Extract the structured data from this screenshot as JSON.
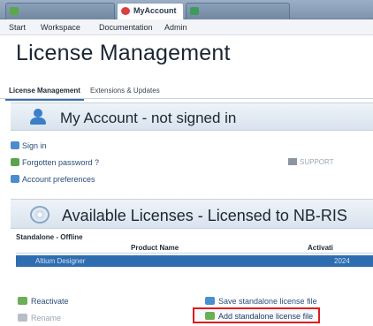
{
  "tabs": [
    {
      "label": "",
      "active": false
    },
    {
      "label": "MyAccount",
      "active": true
    },
    {
      "label": "",
      "active": false
    }
  ],
  "menu": {
    "start": "Start",
    "workspace": "Workspace",
    "documentation": "Documentation",
    "admin": "Admin"
  },
  "page": {
    "title": "License Management"
  },
  "subtabs": {
    "license_management": "License Management",
    "extensions_updates": "Extensions & Updates"
  },
  "account": {
    "title": "My Account - not signed in",
    "links": {
      "sign_in": "Sign in",
      "forgotten_password": "Forgotten password ?",
      "account_preferences": "Account preferences",
      "support": "SUPPORT"
    }
  },
  "licenses": {
    "title": "Available Licenses - Licensed to NB-RIS",
    "group": "Standalone - Offline",
    "columns": {
      "product_name": "Product Name",
      "activation": "Activati"
    },
    "rows": [
      {
        "product_name": "Altium Designer",
        "activation": "2024"
      }
    ]
  },
  "actions": {
    "reactivate": "Reactivate",
    "rename": "Rename",
    "save_standalone": "Save standalone license file",
    "add_standalone": "Add standalone license file"
  },
  "colors": {
    "accent": "#2f6db1",
    "highlight_border": "#e01b1b"
  }
}
